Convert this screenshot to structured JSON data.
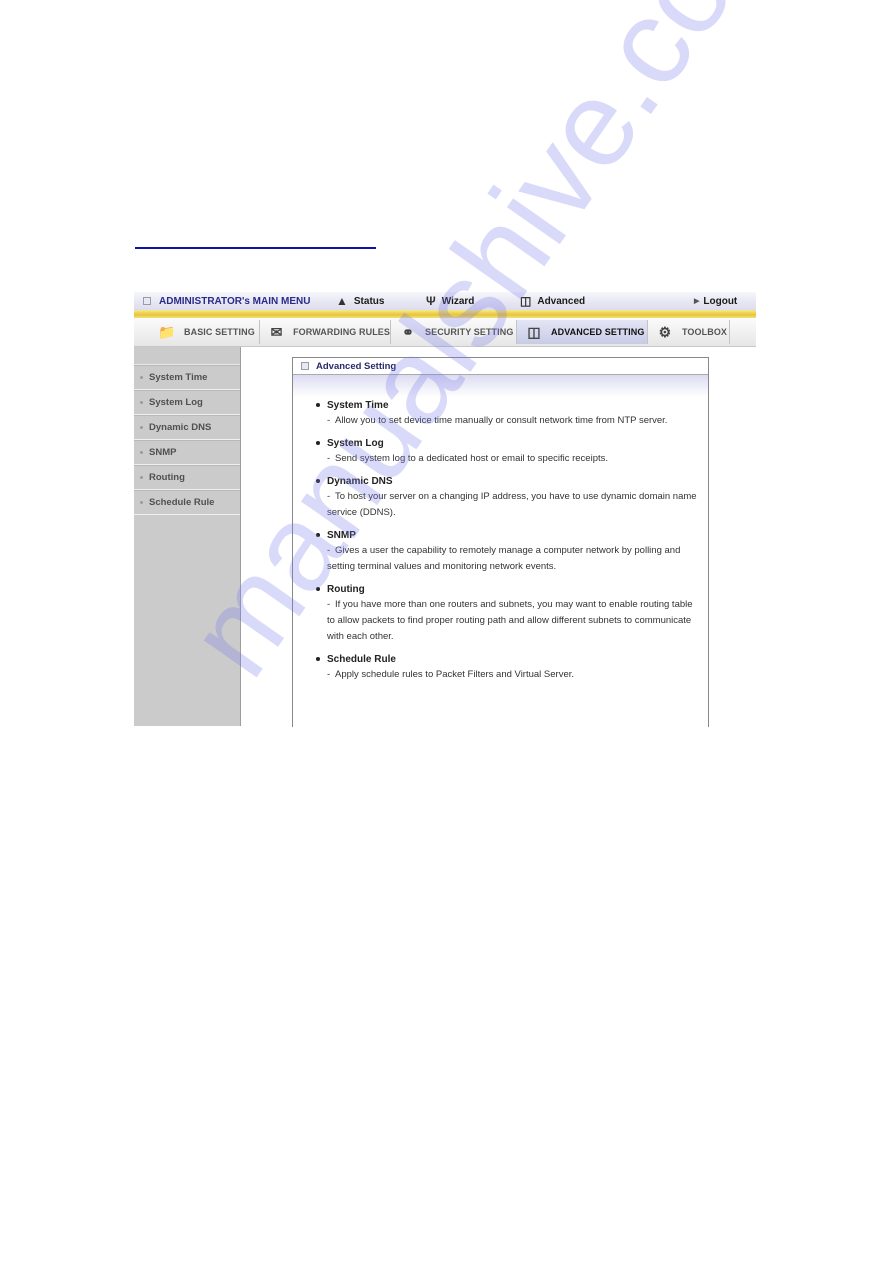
{
  "watermark": "manualshive.com",
  "mainmenu": {
    "title": "ADMINISTRATOR's MAIN MENU",
    "items": [
      {
        "label": "Status",
        "icon": "status-icon"
      },
      {
        "label": "Wizard",
        "icon": "wizard-icon"
      },
      {
        "label": "Advanced",
        "icon": "advanced-icon"
      }
    ],
    "logout": "Logout"
  },
  "tabs": [
    {
      "label": "BASIC SETTING",
      "icon": "folder-icon",
      "active": false
    },
    {
      "label": "FORWARDING RULES",
      "icon": "forwarding-icon",
      "active": false
    },
    {
      "label": "SECURITY SETTING",
      "icon": "security-icon",
      "active": false
    },
    {
      "label": "ADVANCED SETTING",
      "icon": "advanced-setting-icon",
      "active": true
    },
    {
      "label": "TOOLBOX",
      "icon": "toolbox-icon",
      "active": false
    }
  ],
  "sidebar": {
    "items": [
      {
        "label": "System Time"
      },
      {
        "label": "System Log"
      },
      {
        "label": "Dynamic DNS"
      },
      {
        "label": "SNMP"
      },
      {
        "label": "Routing"
      },
      {
        "label": "Schedule Rule"
      }
    ]
  },
  "panel": {
    "title": "Advanced Setting",
    "items": [
      {
        "title": "System Time",
        "desc": "Allow you to set device time manually or consult network time from NTP server."
      },
      {
        "title": "System Log",
        "desc": "Send system log to a dedicated host or email to specific receipts."
      },
      {
        "title": "Dynamic DNS",
        "desc": "To host your server on a changing IP address, you have to use dynamic domain name service (DDNS)."
      },
      {
        "title": "SNMP",
        "desc": "Gives a user the capability to remotely manage a computer network by polling and setting terminal values and monitoring network events."
      },
      {
        "title": "Routing",
        "desc": "If you have more than one routers and subnets, you may want to enable routing table to allow packets to find proper routing path and allow different subnets to communicate with each other."
      },
      {
        "title": "Schedule Rule",
        "desc": "Apply schedule rules to Packet Filters and Virtual Server."
      }
    ]
  }
}
